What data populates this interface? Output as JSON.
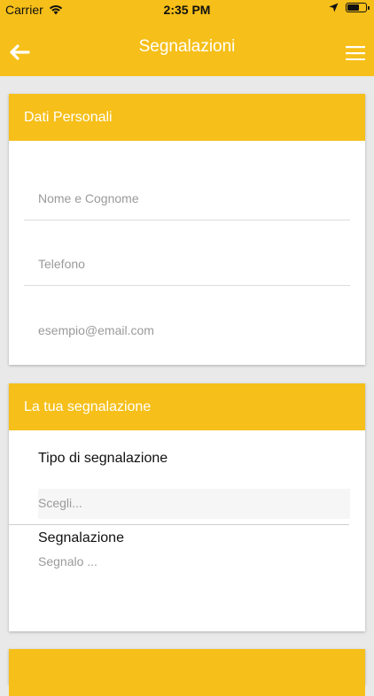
{
  "status_bar": {
    "carrier": "Carrier",
    "time": "2:35 PM"
  },
  "navbar": {
    "title": "Segnalazioni",
    "back_icon": "arrow-left-icon",
    "menu_icon": "hamburger-menu-icon"
  },
  "personal_section": {
    "title": "Dati Personali",
    "name_placeholder": "Nome e Cognome",
    "phone_placeholder": "Telefono",
    "email_placeholder": "esempio@email.com"
  },
  "report_section": {
    "title": "La tua segnalazione",
    "type_label": "Tipo di segnalazione",
    "type_placeholder": "Scegli...",
    "report_label": "Segnalazione",
    "report_placeholder": "Segnalo ..."
  },
  "colors": {
    "accent": "#f6bf19",
    "background": "#e9e9e9"
  }
}
